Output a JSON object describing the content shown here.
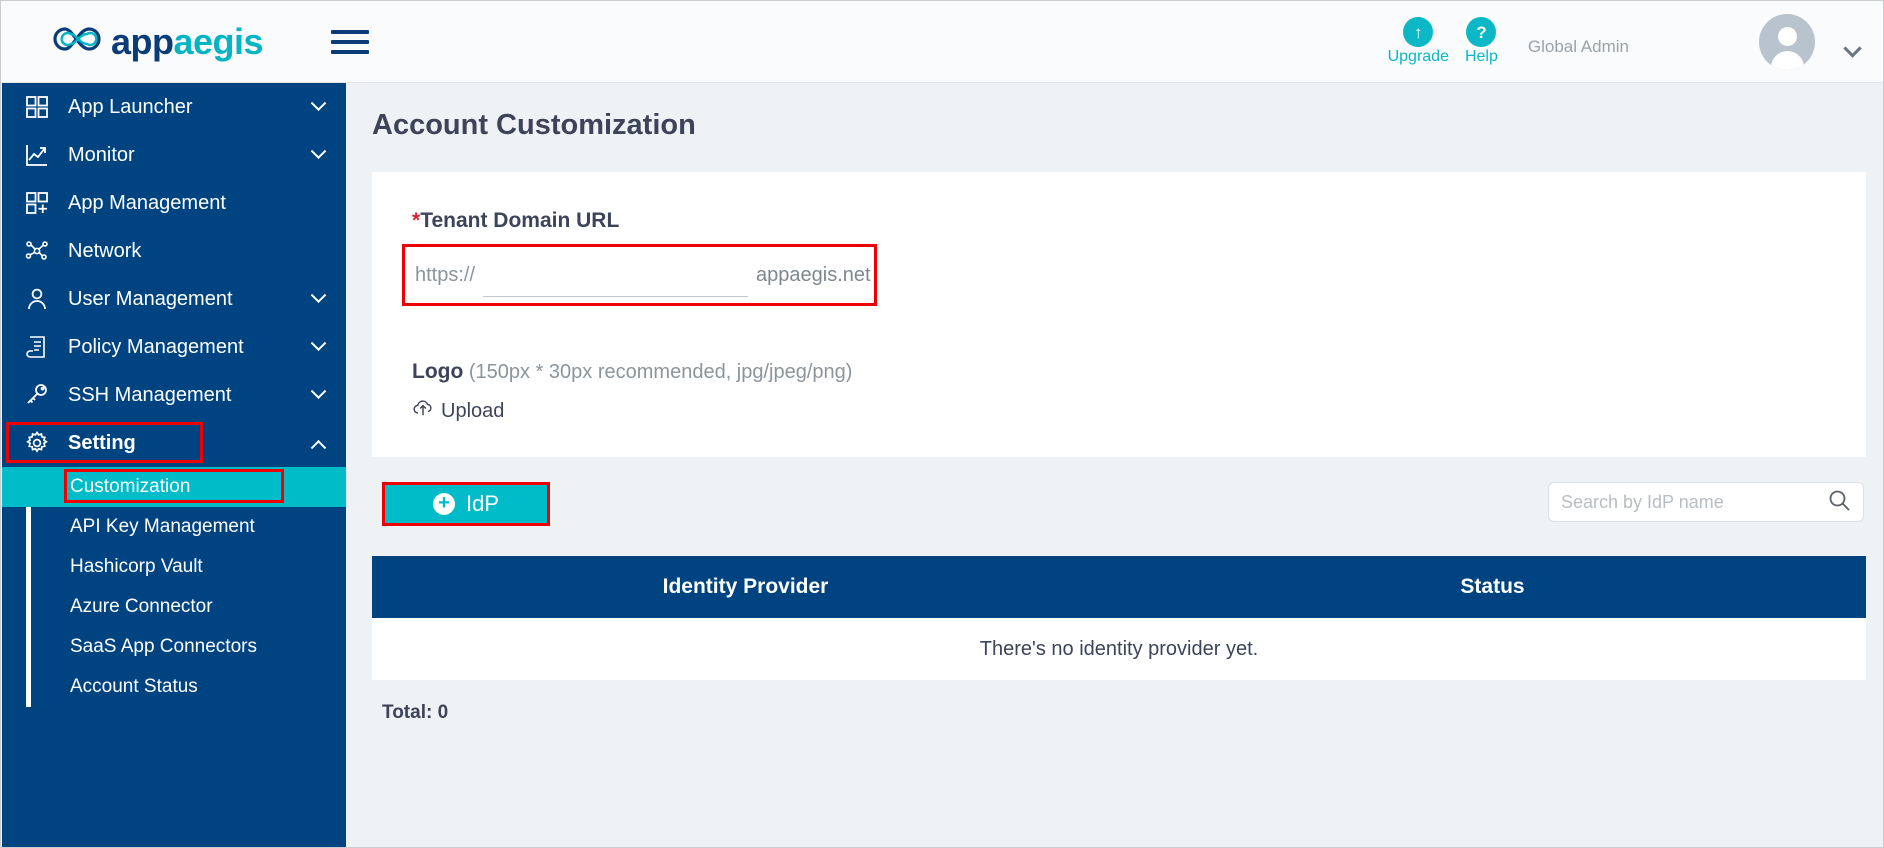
{
  "header": {
    "brand_dark": "app",
    "brand_teal": "aegis",
    "brand_prefix_icon": "infinity-logo",
    "menu_icon": "hamburger-menu-icon",
    "upgrade": {
      "icon": "up-arrow-icon",
      "glyph": "↑",
      "label": "Upgrade"
    },
    "help": {
      "icon": "question-mark-icon",
      "glyph": "?",
      "label": "Help"
    },
    "role": "Global Admin",
    "avatar_icon": "user-avatar-icon",
    "dropdown_icon": "chevron-down-icon"
  },
  "colors": {
    "brand_dark_blue": "#004381",
    "brand_teal": "#00bcc8",
    "highlight_red": "#ee0000",
    "required_star": "#d82036",
    "page_bg": "#eef2f5"
  },
  "sidebar": {
    "items": [
      {
        "label": "App Launcher",
        "icon": "grid-icon",
        "expandable": true,
        "expanded": false
      },
      {
        "label": "Monitor",
        "icon": "chart-line-icon",
        "expandable": true,
        "expanded": false
      },
      {
        "label": "App Management",
        "icon": "grid-plus-icon",
        "expandable": false,
        "expanded": false
      },
      {
        "label": "Network",
        "icon": "network-nodes-icon",
        "expandable": false,
        "expanded": false
      },
      {
        "label": "User Management",
        "icon": "user-icon",
        "expandable": true,
        "expanded": false
      },
      {
        "label": "Policy Management",
        "icon": "document-scroll-icon",
        "expandable": true,
        "expanded": false
      },
      {
        "label": "SSH Management",
        "icon": "key-icon",
        "expandable": true,
        "expanded": false
      },
      {
        "label": "Setting",
        "icon": "gear-icon",
        "expandable": true,
        "expanded": true,
        "highlighted": true
      }
    ],
    "submenu": [
      {
        "label": "Customization",
        "active": true,
        "highlighted": true
      },
      {
        "label": "API Key Management",
        "active": false,
        "highlighted": false
      },
      {
        "label": "Hashicorp Vault",
        "active": false,
        "highlighted": false
      },
      {
        "label": "Azure Connector",
        "active": false,
        "highlighted": false
      },
      {
        "label": "SaaS App Connectors",
        "active": false,
        "highlighted": false
      },
      {
        "label": "Account Status",
        "active": false,
        "highlighted": false
      }
    ]
  },
  "main": {
    "page_title": "Account Customization",
    "domain": {
      "required_star": "*",
      "label": "Tenant Domain URL",
      "protocol": "https://",
      "value": "",
      "placeholder": "",
      "suffix": "appaegis.net"
    },
    "logo": {
      "label": "Logo",
      "hint": "(150px * 30px recommended, jpg/jpeg/png)",
      "upload_label": "Upload",
      "upload_icon": "cloud-upload-icon"
    },
    "toolbar": {
      "idp_button_label": "IdP",
      "idp_button_icon": "plus-circle-icon",
      "search_placeholder": "Search by IdP name",
      "search_value": "",
      "search_icon": "search-icon"
    },
    "table": {
      "columns": [
        "Identity Provider",
        "Status"
      ],
      "rows": [],
      "empty_message": "There's no identity provider yet.",
      "total_label": "Total: 0"
    }
  }
}
